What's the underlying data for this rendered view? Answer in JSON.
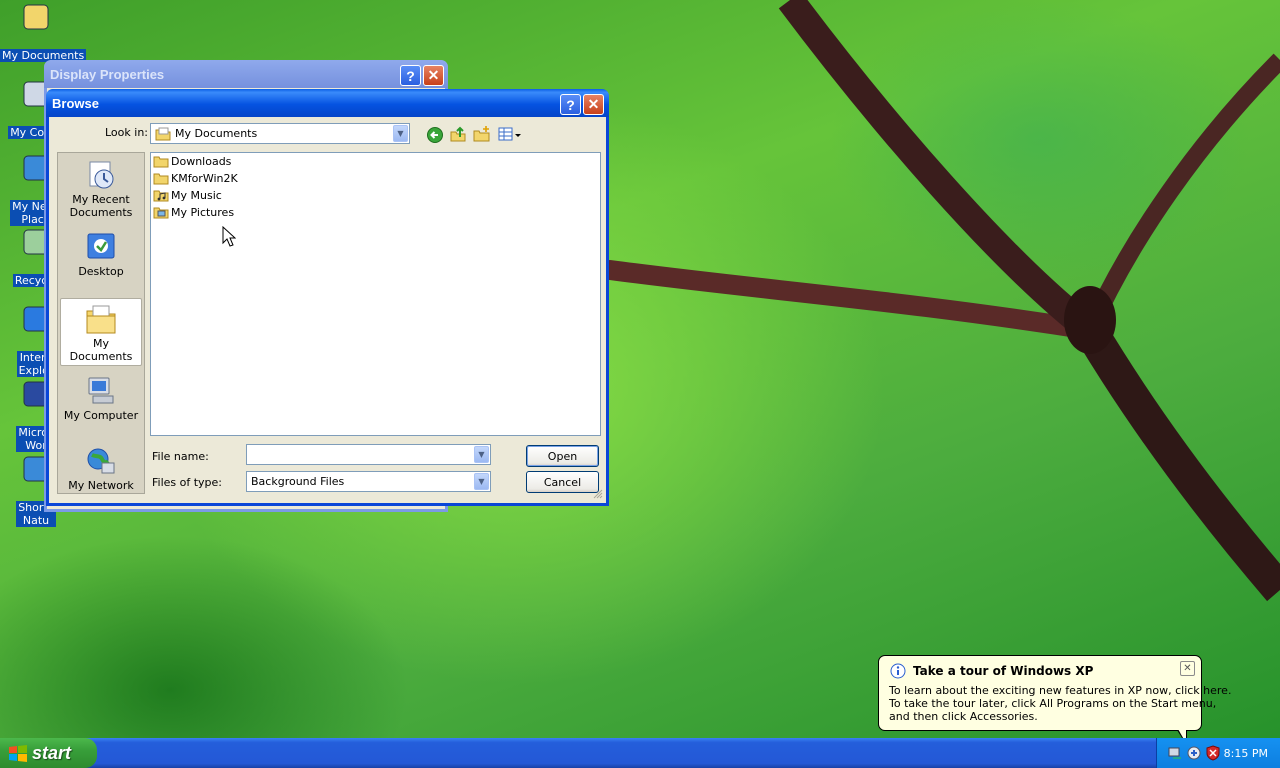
{
  "desktop": {
    "icons": [
      {
        "label": "My Documents",
        "icon": "my-documents-icon"
      },
      {
        "label": "My Comp",
        "icon": "my-computer-icon"
      },
      {
        "label": "My Netw\nPlace",
        "icon": "my-network-places-icon"
      },
      {
        "label": "Recycle",
        "icon": "recycle-bin-icon"
      },
      {
        "label": "Intern\nExplor",
        "icon": "internet-explorer-icon"
      },
      {
        "label": "Micros\nWor",
        "icon": "microsoft-word-icon"
      },
      {
        "label": "Shortc\nNatu",
        "icon": "shortcut-icon"
      }
    ]
  },
  "display_properties": {
    "title": "Display Properties",
    "help_label": "?",
    "close_label": "✕"
  },
  "browse": {
    "title": "Browse",
    "help_label": "?",
    "close_label": "✕",
    "look_in_label": "Look in:",
    "look_in_value": "My Documents",
    "places": [
      {
        "label": "My Recent\nDocuments",
        "icon": "recent-documents-icon"
      },
      {
        "label": "Desktop",
        "icon": "desktop-icon"
      },
      {
        "label": "My Documents",
        "icon": "my-documents-icon",
        "selected": true
      },
      {
        "label": "My Computer",
        "icon": "my-computer-icon"
      },
      {
        "label": "My Network",
        "icon": "my-network-icon"
      }
    ],
    "files": [
      {
        "name": "Downloads",
        "icon": "folder-icon"
      },
      {
        "name": "KMforWin2K",
        "icon": "folder-icon"
      },
      {
        "name": "My Music",
        "icon": "music-folder-icon"
      },
      {
        "name": "My Pictures",
        "icon": "pictures-folder-icon"
      }
    ],
    "file_name_label": "File name:",
    "file_name_value": "",
    "files_of_type_label": "Files of type:",
    "files_of_type_value": "Background Files",
    "open_label": "Open",
    "cancel_label": "Cancel"
  },
  "taskbar": {
    "start_label": "start",
    "clock": "8:15 PM"
  },
  "balloon": {
    "title": "Take a tour of Windows XP",
    "body": "To learn about the exciting new features in XP now, click here.\nTo take the tour later, click All Programs on the Start menu,\nand then click Accessories.",
    "close_label": "✕"
  },
  "colors": {
    "title_active": "#0553e1",
    "title_inactive": "#7b9ae7",
    "taskbar": "#245edb",
    "start": "#389f3a"
  }
}
